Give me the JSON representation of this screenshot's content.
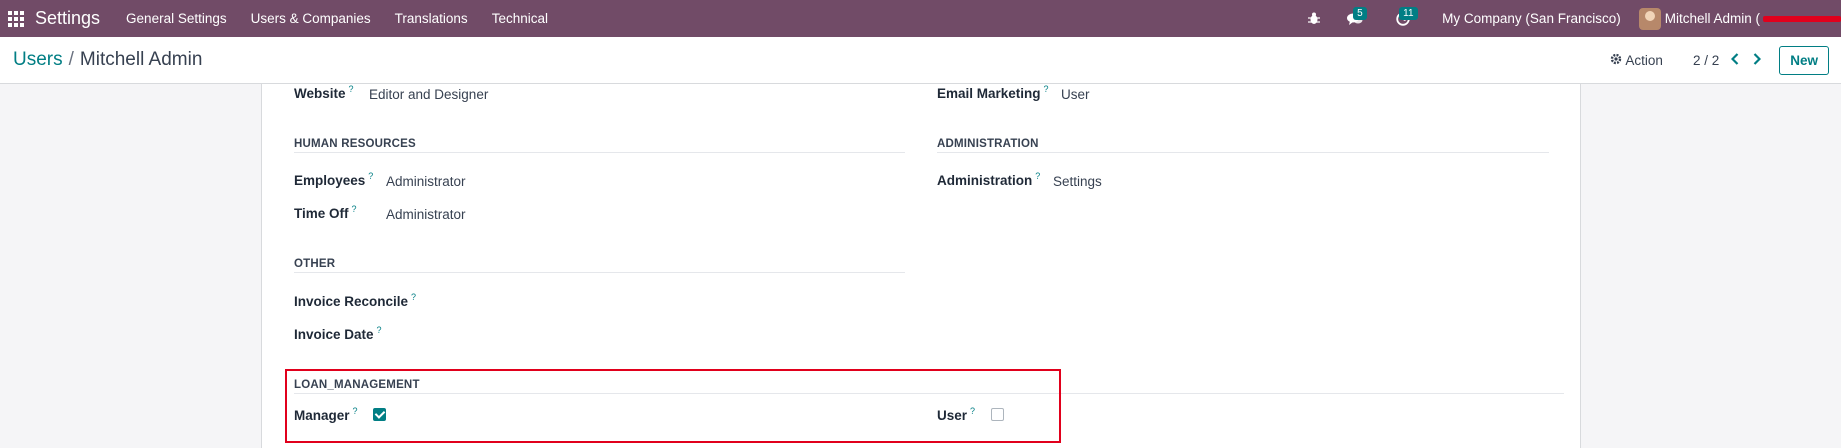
{
  "navbar": {
    "app_title": "Settings",
    "menu": [
      "General Settings",
      "Users & Companies",
      "Translations",
      "Technical"
    ],
    "messages_count": "5",
    "activities_count": "11",
    "company": "My Company (San Francisco)",
    "user_name": "Mitchell Admin ("
  },
  "control": {
    "breadcrumb_parent": "Users",
    "breadcrumb_sep": "/",
    "breadcrumb_current": "Mitchell Admin",
    "action_label": "Action",
    "pager": "2 / 2",
    "new_label": "New"
  },
  "form": {
    "website_label": "Website",
    "website_value": "Editor and Designer",
    "email_marketing_label": "Email Marketing",
    "email_marketing_value": "User",
    "hr_section": "HUMAN RESOURCES",
    "employees_label": "Employees",
    "employees_value": "Administrator",
    "timeoff_label": "Time Off",
    "timeoff_value": "Administrator",
    "admin_section": "ADMINISTRATION",
    "administration_label": "Administration",
    "administration_value": "Settings",
    "other_section": "OTHER",
    "invoice_reconcile_label": "Invoice Reconcile",
    "invoice_date_label": "Invoice Date",
    "loan_section": "LOAN_MANAGEMENT",
    "manager_label": "Manager",
    "manager_checked": true,
    "user_label": "User",
    "user_checked": false,
    "help_mark": "?"
  },
  "colors": {
    "navbar": "#714b67",
    "accent": "#017e84",
    "highlight": "#e1001c"
  },
  "icons": [
    "apps-grid-icon",
    "bug-icon",
    "chat-icon",
    "clock-icon",
    "gear-icon",
    "chevron-left-icon",
    "chevron-right-icon",
    "check-icon"
  ]
}
